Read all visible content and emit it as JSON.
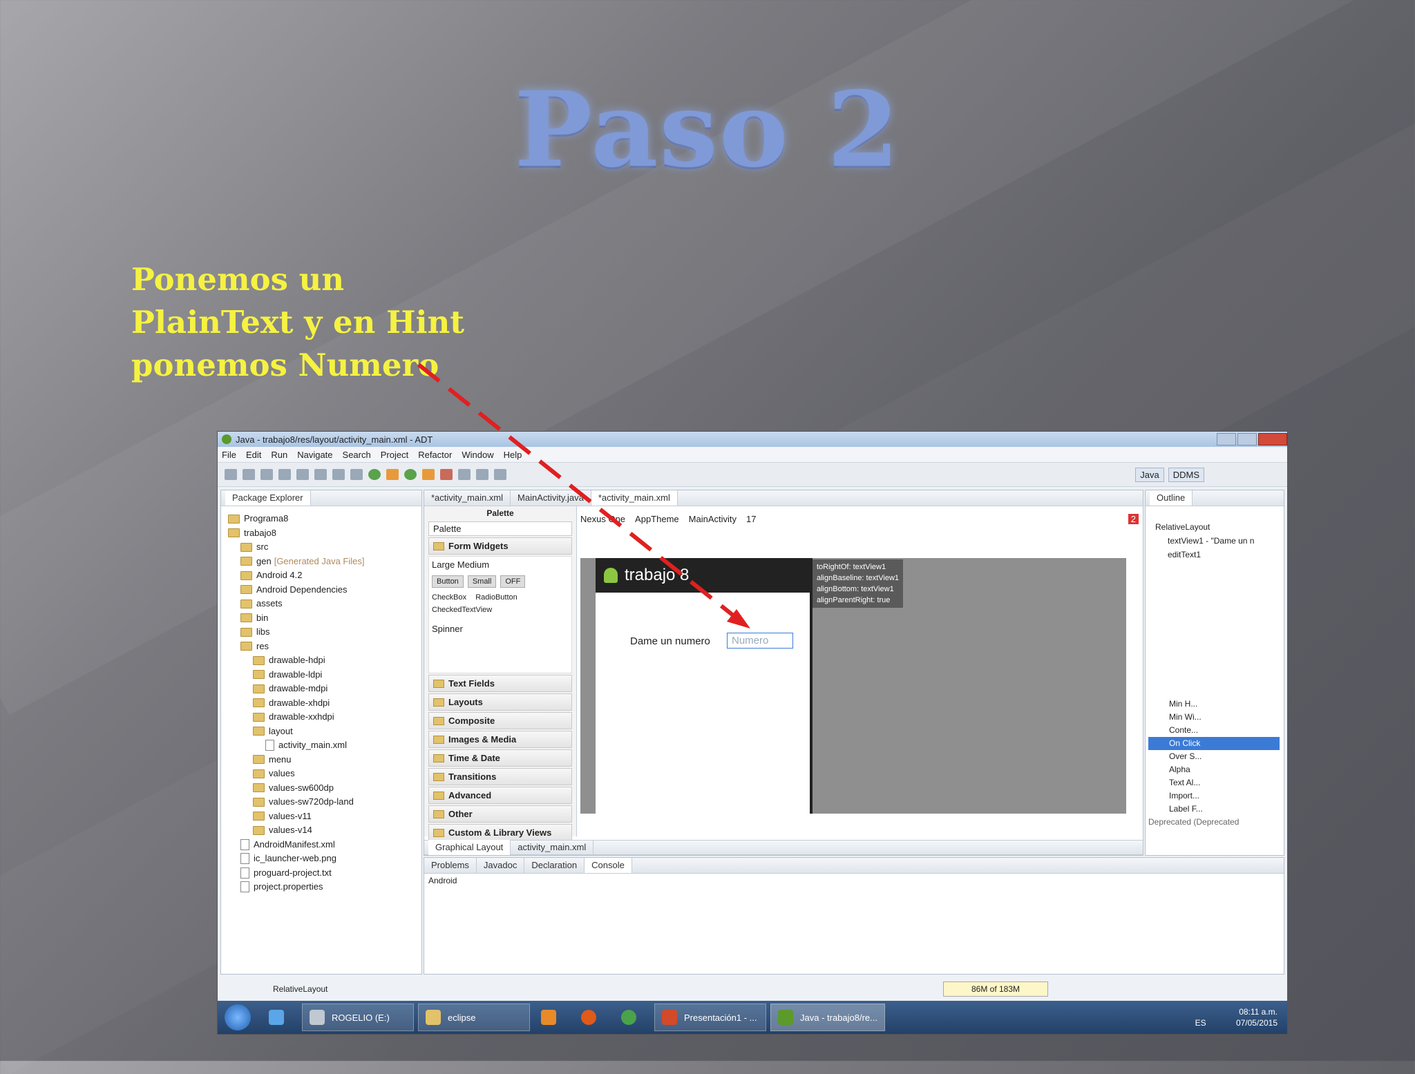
{
  "slide": {
    "title": "Paso 2",
    "caption_lines": [
      "Ponemos un",
      "PlainText y en Hint",
      "ponemos Numero"
    ]
  },
  "window": {
    "title": "Java - trabajo8/res/layout/activity_main.xml - ADT",
    "menu": [
      "File",
      "Edit",
      "Run",
      "Navigate",
      "Search",
      "Project",
      "Refactor",
      "Window",
      "Help"
    ],
    "perspectives": [
      "Java",
      "DDMS"
    ]
  },
  "package_explorer": {
    "tab": "Package Explorer",
    "items": [
      {
        "label": "Programa8",
        "type": "project"
      },
      {
        "label": "trabajo8",
        "type": "project"
      },
      {
        "label": "src",
        "type": "folder"
      },
      {
        "label": "gen",
        "note": "[Generated Java Files]",
        "type": "folder"
      },
      {
        "label": "Android 4.2",
        "type": "folder"
      },
      {
        "label": "Android Dependencies",
        "type": "folder"
      },
      {
        "label": "assets",
        "type": "folder"
      },
      {
        "label": "bin",
        "type": "folder"
      },
      {
        "label": "libs",
        "type": "folder"
      },
      {
        "label": "res",
        "type": "folder"
      },
      {
        "label": "drawable-hdpi",
        "type": "folder"
      },
      {
        "label": "drawable-ldpi",
        "type": "folder"
      },
      {
        "label": "drawable-mdpi",
        "type": "folder"
      },
      {
        "label": "drawable-xhdpi",
        "type": "folder"
      },
      {
        "label": "drawable-xxhdpi",
        "type": "folder"
      },
      {
        "label": "layout",
        "type": "folder"
      },
      {
        "label": "activity_main.xml",
        "type": "file"
      },
      {
        "label": "menu",
        "type": "folder"
      },
      {
        "label": "values",
        "type": "folder"
      },
      {
        "label": "values-sw600dp",
        "type": "folder"
      },
      {
        "label": "values-sw720dp-land",
        "type": "folder"
      },
      {
        "label": "values-v11",
        "type": "folder"
      },
      {
        "label": "values-v14",
        "type": "folder"
      },
      {
        "label": "AndroidManifest.xml",
        "type": "file"
      },
      {
        "label": "ic_launcher-web.png",
        "type": "file"
      },
      {
        "label": "proguard-project.txt",
        "type": "file"
      },
      {
        "label": "project.properties",
        "type": "file"
      }
    ],
    "status": "RelativeLayout"
  },
  "editor": {
    "tabs": [
      "*activity_main.xml",
      "MainActivity.java",
      "*activity_main.xml"
    ],
    "palette_title": "Palette",
    "palette_header": "Palette",
    "palette_groups": [
      "Form Widgets",
      "Text Fields",
      "Layouts",
      "Composite",
      "Images & Media",
      "Time & Date",
      "Transitions",
      "Advanced",
      "Other",
      "Custom & Library Views"
    ],
    "form_widgets": {
      "text_sizes": "Large Medium",
      "buttons": [
        "Button",
        "Small",
        "OFF"
      ],
      "checks": [
        "CheckBox",
        "RadioButton"
      ],
      "checked_text": "CheckedTextView",
      "spinner": "Spinner"
    },
    "toolbar": {
      "device": "Nexus One",
      "theme": "AppTheme",
      "activity": "MainActivity",
      "api": "17",
      "errors": "2"
    },
    "app_title": "trabajo 8",
    "label_text": "Dame un numero",
    "edit_hint": "Numero",
    "tooltip": [
      "toRightOf: textView1",
      "alignBaseline: textView1",
      "alignBottom: textView1",
      "alignParentRight: true"
    ],
    "bottom_tabs": [
      "Graphical Layout",
      "activity_main.xml"
    ]
  },
  "outline": {
    "tab": "Outline",
    "items": [
      "RelativeLayout",
      "textView1 - \"Dame un n",
      "editText1"
    ],
    "properties": [
      "Min H...",
      "Min Wi...",
      "Conte...",
      "On Click",
      "Over S...",
      "Alpha",
      "Text Al...",
      "Import...",
      "Label F..."
    ],
    "deprecated": "Deprecated (Deprecated"
  },
  "console": {
    "tabs": [
      "Problems",
      "Javadoc",
      "Declaration",
      "Console"
    ],
    "content": "Android",
    "memory": "86M of 183M"
  },
  "taskbar": {
    "items": [
      "ROGELIO (E:)",
      "eclipse",
      "Presentación1 - ...",
      "Java - trabajo8/re..."
    ],
    "lang": "ES",
    "time": "08:11 a.m.",
    "date": "07/05/2015"
  },
  "colors": {
    "caption": "#f6f241",
    "title": "#7f9ad6",
    "arrow": "#e02020"
  }
}
